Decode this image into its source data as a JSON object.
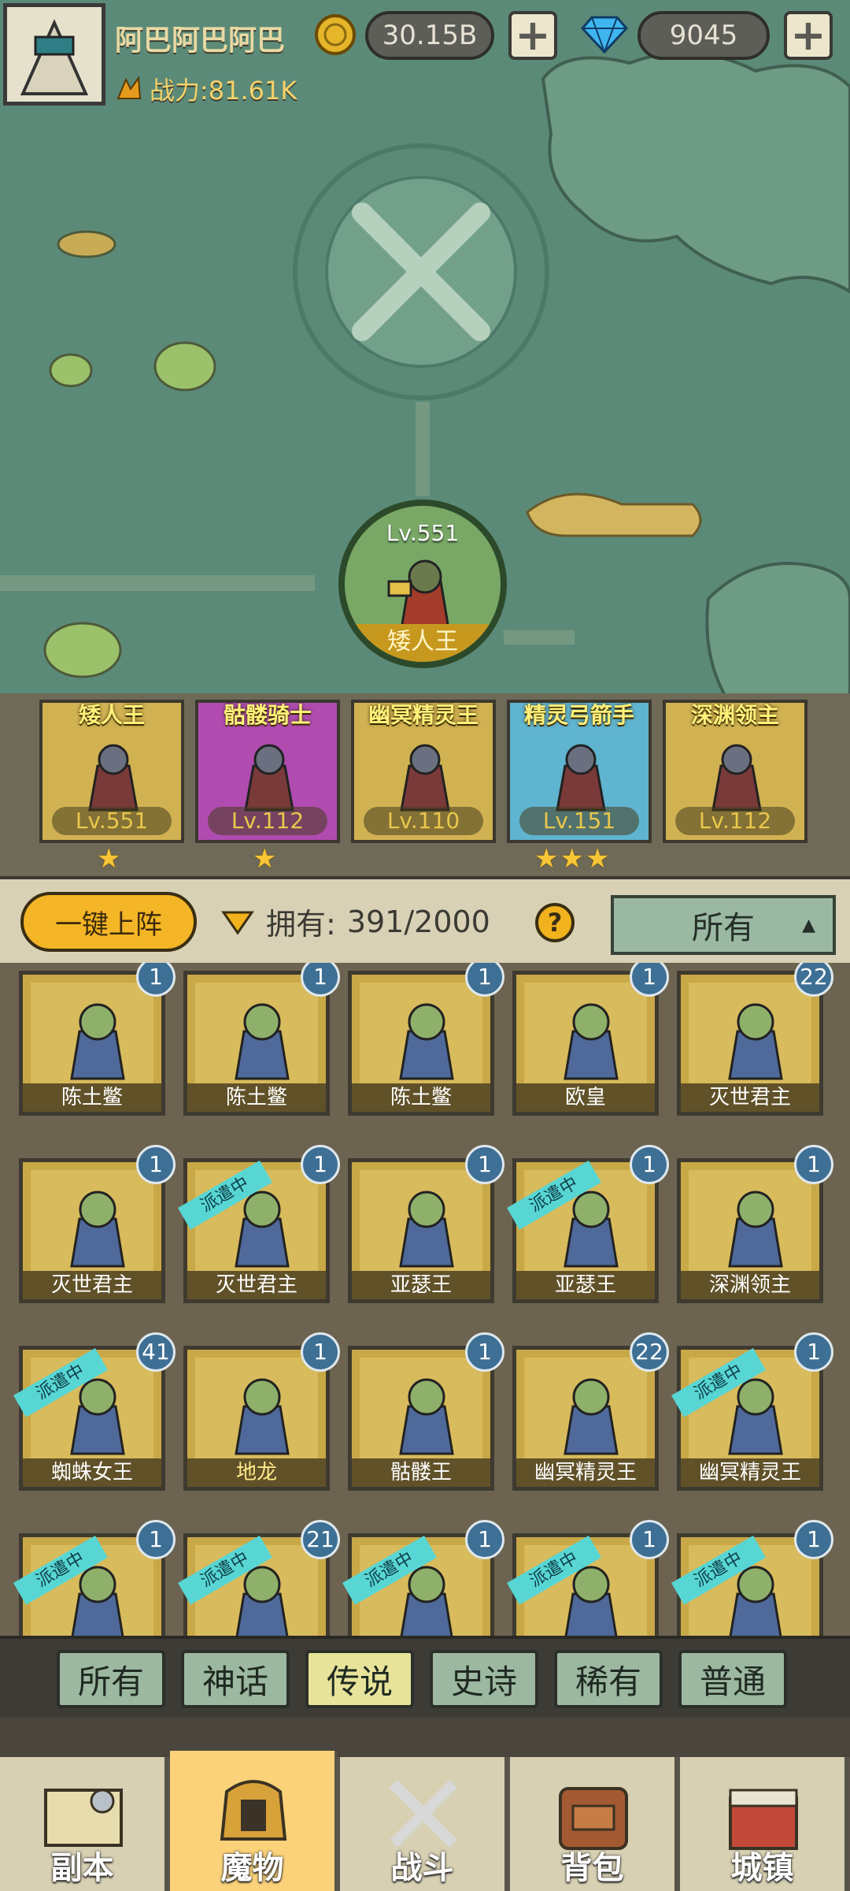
{
  "header": {
    "player_name": "阿巴阿巴阿巴",
    "power_label": "战力:81.61K",
    "gold": "30.15B",
    "gems": "9045",
    "add_symbol": "+"
  },
  "stage": {
    "boss_level": "Lv.551",
    "boss_name": "矮人王"
  },
  "lineup": [
    {
      "name": "矮人王",
      "level": "Lv.551",
      "stars": 1
    },
    {
      "name": "骷髅骑士",
      "level": "Lv.112",
      "stars": 1
    },
    {
      "name": "幽冥精灵王",
      "level": "Lv.110",
      "stars": 0
    },
    {
      "name": "精灵弓箭手",
      "level": "Lv.151",
      "stars": 3
    },
    {
      "name": "深渊领主",
      "level": "Lv.112",
      "stars": 0
    }
  ],
  "toolbar": {
    "one_key_label": "一键上阵",
    "own_label": "拥有:",
    "own_count": "391/2000",
    "help_symbol": "?",
    "filter_value": "所有"
  },
  "roster": [
    {
      "name": "陈土鳖",
      "count": "1",
      "dispatched": false
    },
    {
      "name": "陈土鳖",
      "count": "1",
      "dispatched": false
    },
    {
      "name": "陈土鳖",
      "count": "1",
      "dispatched": false
    },
    {
      "name": "欧皇",
      "count": "1",
      "dispatched": false
    },
    {
      "name": "灭世君主",
      "count": "22",
      "dispatched": false
    },
    {
      "name": "灭世君主",
      "count": "1",
      "dispatched": false
    },
    {
      "name": "灭世君主",
      "count": "1",
      "dispatched": true
    },
    {
      "name": "亚瑟王",
      "count": "1",
      "dispatched": false
    },
    {
      "name": "亚瑟王",
      "count": "1",
      "dispatched": true
    },
    {
      "name": "深渊领主",
      "count": "1",
      "dispatched": false
    },
    {
      "name": "蜘蛛女王",
      "count": "41",
      "dispatched": true
    },
    {
      "name": "地龙",
      "count": "1",
      "dispatched": false
    },
    {
      "name": "骷髅王",
      "count": "1",
      "dispatched": false
    },
    {
      "name": "幽冥精灵王",
      "count": "22",
      "dispatched": false
    },
    {
      "name": "幽冥精灵王",
      "count": "1",
      "dispatched": true
    },
    {
      "name": "",
      "count": "1",
      "dispatched": true
    },
    {
      "name": "",
      "count": "21",
      "dispatched": true
    },
    {
      "name": "",
      "count": "1",
      "dispatched": true
    },
    {
      "name": "",
      "count": "1",
      "dispatched": true
    },
    {
      "name": "",
      "count": "1",
      "dispatched": true
    }
  ],
  "dispatched_label": "派遣中",
  "rarity_tabs": [
    "所有",
    "神话",
    "传说",
    "史诗",
    "稀有",
    "普通"
  ],
  "rarity_active": 2,
  "nav": [
    "副本",
    "魔物",
    "战斗",
    "背包",
    "城镇"
  ],
  "nav_active": 1,
  "colors": {
    "map": "#5c8a78",
    "card_gold": "#c9a847",
    "badge_blue": "#3e6f94",
    "ribbon_cyan": "#58d6d4",
    "active_nav": "#fbd27a"
  }
}
